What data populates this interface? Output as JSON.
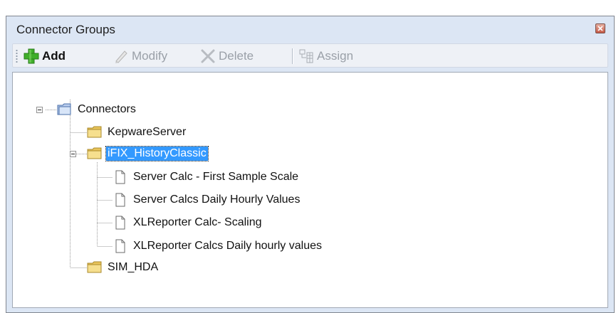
{
  "window": {
    "title": "Connector Groups"
  },
  "toolbar": {
    "add_label": "Add",
    "modify_label": "Modify",
    "delete_label": "Delete",
    "assign_label": "Assign"
  },
  "tree": {
    "root": {
      "label": "Connectors",
      "expanded": true,
      "icon": "folder-icon"
    },
    "groups": [
      {
        "label": "KepwareServer",
        "icon": "folder-icon",
        "selected": false
      },
      {
        "label": "iFIX_HistoryClassic",
        "icon": "folder-icon",
        "selected": true,
        "expanded": true,
        "children": [
          {
            "label": "Server Calc - First Sample Scale",
            "icon": "document-icon"
          },
          {
            "label": "Server Calcs Daily Hourly Values",
            "icon": "document-icon"
          },
          {
            "label": "XLReporter Calc- Scaling",
            "icon": "document-icon"
          },
          {
            "label": "XLReporter Calcs Daily hourly values",
            "icon": "document-icon"
          }
        ]
      },
      {
        "label": "SIM_HDA",
        "icon": "folder-icon",
        "selected": false
      }
    ]
  },
  "colors": {
    "panel_background": "#dce6f4",
    "selection": "#3399ff",
    "add_icon": "#3fae2a",
    "folder": "#f2d77a"
  }
}
